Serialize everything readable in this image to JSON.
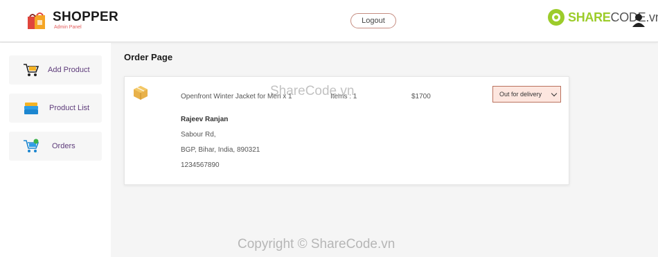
{
  "brand": {
    "title": "SHOPPER",
    "subtitle": "Admin Panel"
  },
  "header": {
    "logout_label": "Logout"
  },
  "watermark_logo": {
    "green": "SHARE",
    "dark": "CODE.vn"
  },
  "sidebar": {
    "items": [
      {
        "label": "Add Product",
        "icon": "cart-icon"
      },
      {
        "label": "Product List",
        "icon": "stack-icon"
      },
      {
        "label": "Orders",
        "icon": "cart-check-icon"
      }
    ]
  },
  "main": {
    "page_title": "Order Page",
    "order": {
      "item_name": "Openfront Winter Jacket for Men x 1",
      "items_count": "Items : 1",
      "price": "$1700",
      "status": "Out for delivery",
      "customer_name": "Rajeev Ranjan",
      "street": "Sabour Rd,",
      "city_line": "BGP, Bihar, India, 890321",
      "phone": "1234567890"
    }
  },
  "watermarks": {
    "center": "ShareCode.vn",
    "bottom": "Copyright © ShareCode.vn"
  },
  "colors": {
    "accent_purple": "#5d3b7a",
    "status_bg": "#fde6df",
    "status_border": "#b9715e",
    "logo_green": "#9ccc2a"
  }
}
